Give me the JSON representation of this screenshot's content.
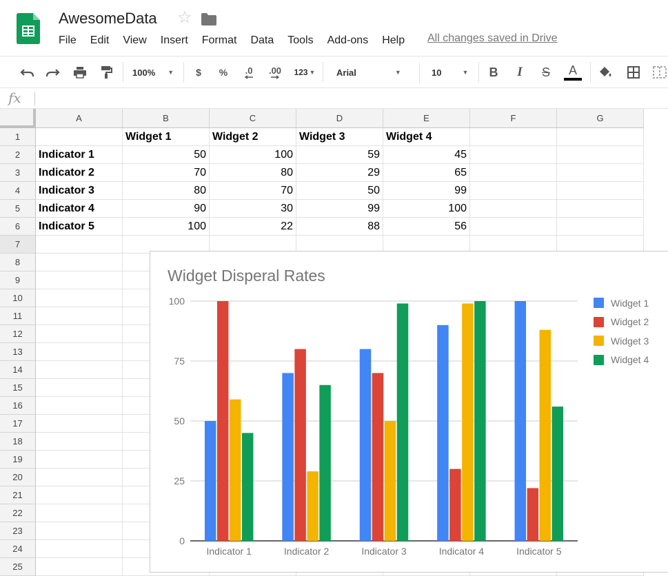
{
  "app": {
    "title": "AwesomeData",
    "save_status": "All changes saved in Drive",
    "menu": [
      "File",
      "Edit",
      "View",
      "Insert",
      "Format",
      "Data",
      "Tools",
      "Add-ons",
      "Help"
    ]
  },
  "toolbar": {
    "zoom": "100%",
    "currency": "$",
    "percent": "%",
    "decrease_decimal": ".0",
    "increase_decimal": ".00",
    "more_formats": "123",
    "font": "Arial",
    "font_size": "10",
    "bold": "B",
    "italic": "I",
    "strikethrough": "S",
    "text_color": "A"
  },
  "formula_bar": {
    "fx": "fx",
    "value": ""
  },
  "sheet": {
    "columns": [
      "A",
      "B",
      "C",
      "D",
      "E",
      "F",
      "G"
    ],
    "rows": [
      "1",
      "2",
      "3",
      "4",
      "5",
      "6",
      "7",
      "8",
      "9",
      "10",
      "11",
      "12",
      "13",
      "14",
      "15",
      "16",
      "17",
      "18",
      "19",
      "20",
      "21",
      "22",
      "23",
      "24",
      "25"
    ],
    "header_row": [
      "",
      "Widget 1",
      "Widget 2",
      "Widget 3",
      "Widget 4"
    ],
    "data_rows": [
      {
        "label": "Indicator 1",
        "values": [
          "50",
          "100",
          "59",
          "45"
        ]
      },
      {
        "label": "Indicator 2",
        "values": [
          "70",
          "80",
          "29",
          "65"
        ]
      },
      {
        "label": "Indicator 3",
        "values": [
          "80",
          "70",
          "50",
          "99"
        ]
      },
      {
        "label": "Indicator 4",
        "values": [
          "90",
          "30",
          "99",
          "100"
        ]
      },
      {
        "label": "Indicator 5",
        "values": [
          "100",
          "22",
          "88",
          "56"
        ]
      }
    ]
  },
  "chart_data": {
    "type": "bar",
    "title": "Widget Disperal Rates",
    "categories": [
      "Indicator 1",
      "Indicator 2",
      "Indicator 3",
      "Indicator 4",
      "Indicator 5"
    ],
    "series": [
      {
        "name": "Widget 1",
        "values": [
          50,
          70,
          80,
          90,
          100
        ],
        "color": "#4285f4"
      },
      {
        "name": "Widget 2",
        "values": [
          100,
          80,
          70,
          30,
          22
        ],
        "color": "#db4437"
      },
      {
        "name": "Widget 3",
        "values": [
          59,
          29,
          50,
          99,
          88
        ],
        "color": "#f4b400"
      },
      {
        "name": "Widget 4",
        "values": [
          45,
          65,
          99,
          100,
          56
        ],
        "color": "#0f9d58"
      }
    ],
    "yticks": [
      "0",
      "25",
      "50",
      "75",
      "100"
    ],
    "ylim": [
      0,
      100
    ],
    "grid": true,
    "legend": "right"
  }
}
